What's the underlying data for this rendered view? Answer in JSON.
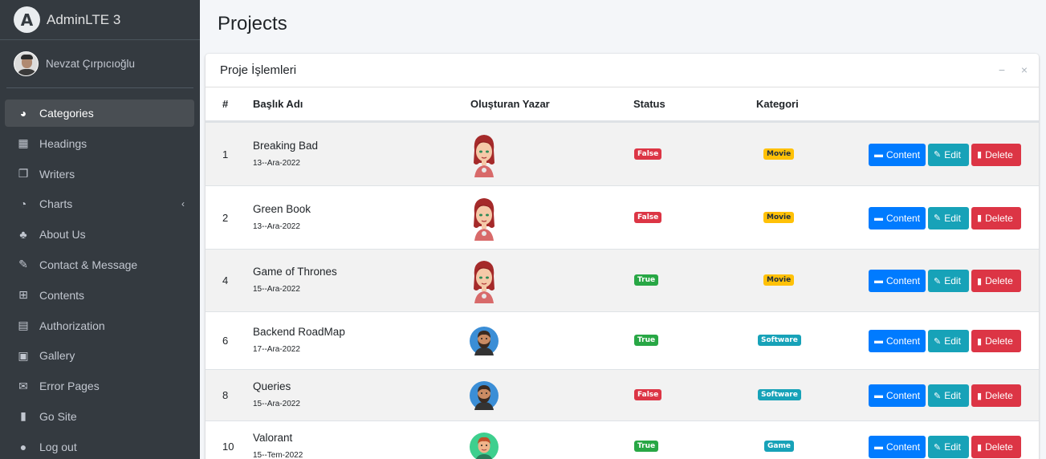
{
  "brand": {
    "name": "AdminLTE 3",
    "logo_letter": "A"
  },
  "user": {
    "name": "Nevzat Çırpıcıoğlu"
  },
  "nav": [
    {
      "label": "Categories",
      "icon": "dashboard-icon",
      "glyph": "◕",
      "active": true
    },
    {
      "label": "Headings",
      "icon": "grid-icon",
      "glyph": "▦"
    },
    {
      "label": "Writers",
      "icon": "copy-icon",
      "glyph": "❐"
    },
    {
      "label": "Charts",
      "icon": "pie-chart-icon",
      "glyph": "◔",
      "caret": "‹"
    },
    {
      "label": "About Us",
      "icon": "tree-icon",
      "glyph": "♣"
    },
    {
      "label": "Contact & Message",
      "icon": "edit-icon",
      "glyph": "✎"
    },
    {
      "label": "Contents",
      "icon": "table-icon",
      "glyph": "⊞"
    },
    {
      "label": "Authorization",
      "icon": "calendar-icon",
      "glyph": "▤"
    },
    {
      "label": "Gallery",
      "icon": "image-icon",
      "glyph": "▣"
    },
    {
      "label": "Error Pages",
      "icon": "envelope-icon",
      "glyph": "✉"
    },
    {
      "label": "Go Site",
      "icon": "book-icon",
      "glyph": "▮"
    },
    {
      "label": "Log out",
      "icon": "apple-icon",
      "glyph": "●"
    }
  ],
  "page": {
    "title": "Projects"
  },
  "card": {
    "title": "Proje İşlemleri",
    "minimize": "−",
    "close": "×"
  },
  "table": {
    "headers": {
      "num": "#",
      "title": "Başlık Adı",
      "author": "Oluşturan Yazar",
      "status": "Status",
      "category": "Kategori"
    },
    "rows": [
      {
        "num": "1",
        "title": "Breaking Bad",
        "date": "13--Ara-2022",
        "avatar": "female",
        "status": "False",
        "category": "Movie"
      },
      {
        "num": "2",
        "title": "Green Book",
        "date": "13--Ara-2022",
        "avatar": "female",
        "status": "False",
        "category": "Movie"
      },
      {
        "num": "4",
        "title": "Game of Thrones",
        "date": "15--Ara-2022",
        "avatar": "female",
        "status": "True",
        "category": "Movie"
      },
      {
        "num": "6",
        "title": "Backend RoadMap",
        "date": "17--Ara-2022",
        "avatar": "male-beard",
        "status": "True",
        "category": "Software"
      },
      {
        "num": "8",
        "title": "Queries",
        "date": "15--Ara-2022",
        "avatar": "male-beard",
        "status": "False",
        "category": "Software"
      },
      {
        "num": "10",
        "title": "Valorant",
        "date": "15--Tem-2022",
        "avatar": "male-green",
        "status": "True",
        "category": "Game"
      }
    ],
    "buttons": {
      "content": "Content",
      "edit": "Edit",
      "delete": "Delete"
    }
  },
  "colors": {
    "sidebar": "#343a40",
    "primary": "#007bff",
    "info": "#17a2b8",
    "danger": "#dc3545",
    "success": "#28a745",
    "warning": "#ffc107"
  }
}
